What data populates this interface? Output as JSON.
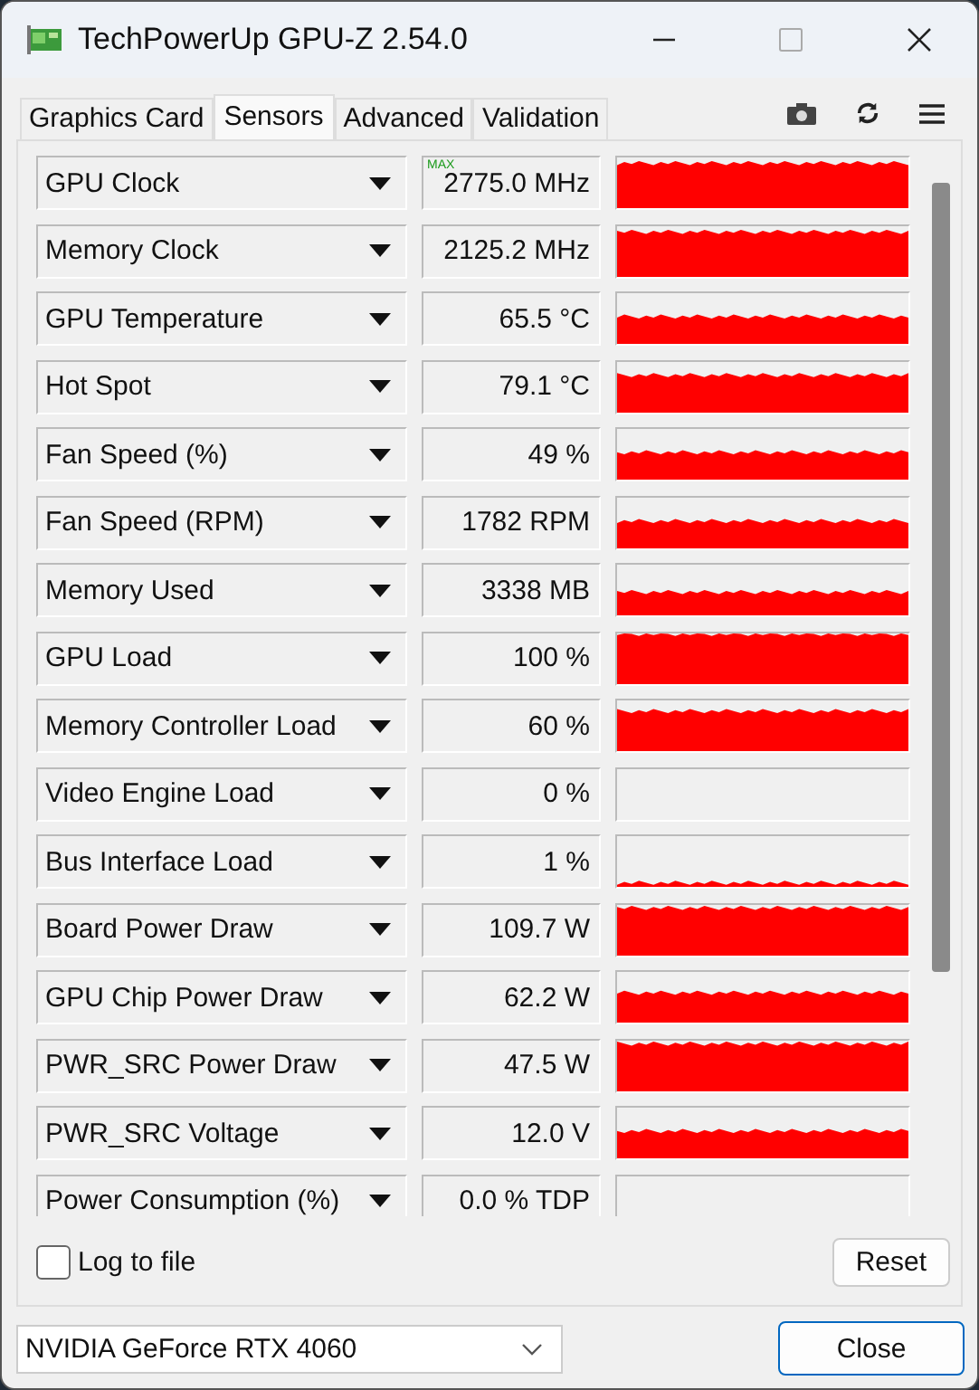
{
  "window": {
    "title": "TechPowerUp GPU-Z 2.54.0"
  },
  "tabs": [
    {
      "label": "Graphics Card",
      "selected": false
    },
    {
      "label": "Sensors",
      "selected": true
    },
    {
      "label": "Advanced",
      "selected": false
    },
    {
      "label": "Validation",
      "selected": false
    }
  ],
  "sensors": [
    {
      "name": "GPU Clock",
      "badge": "MAX",
      "reading": "2775.0 MHz"
    },
    {
      "name": "Memory Clock",
      "reading": "2125.2 MHz"
    },
    {
      "name": "GPU Temperature",
      "reading": "65.5 °C"
    },
    {
      "name": "Hot Spot",
      "reading": "79.1 °C"
    },
    {
      "name": "Fan Speed (%)",
      "reading": "49 %"
    },
    {
      "name": "Fan Speed (RPM)",
      "reading": "1782 RPM"
    },
    {
      "name": "Memory Used",
      "reading": "3338 MB"
    },
    {
      "name": "GPU Load",
      "reading": "100 %"
    },
    {
      "name": "Memory Controller Load",
      "reading": "60 %"
    },
    {
      "name": "Video Engine Load",
      "reading": "0 %"
    },
    {
      "name": "Bus Interface Load",
      "reading": "1 %"
    },
    {
      "name": "Board Power Draw",
      "reading": "109.7 W"
    },
    {
      "name": "GPU Chip Power Draw",
      "reading": "62.2 W"
    },
    {
      "name": "PWR_SRC Power Draw",
      "reading": "47.5 W"
    },
    {
      "name": "PWR_SRC Voltage",
      "reading": "12.0 V"
    },
    {
      "name": "Power Consumption (%)",
      "reading": "0.0 % TDP"
    }
  ],
  "log_to_file": {
    "label": "Log to file",
    "checked": false
  },
  "reset_button": "Reset",
  "device": {
    "value": "NVIDIA GeForce RTX 4060"
  },
  "close_button": "Close"
}
